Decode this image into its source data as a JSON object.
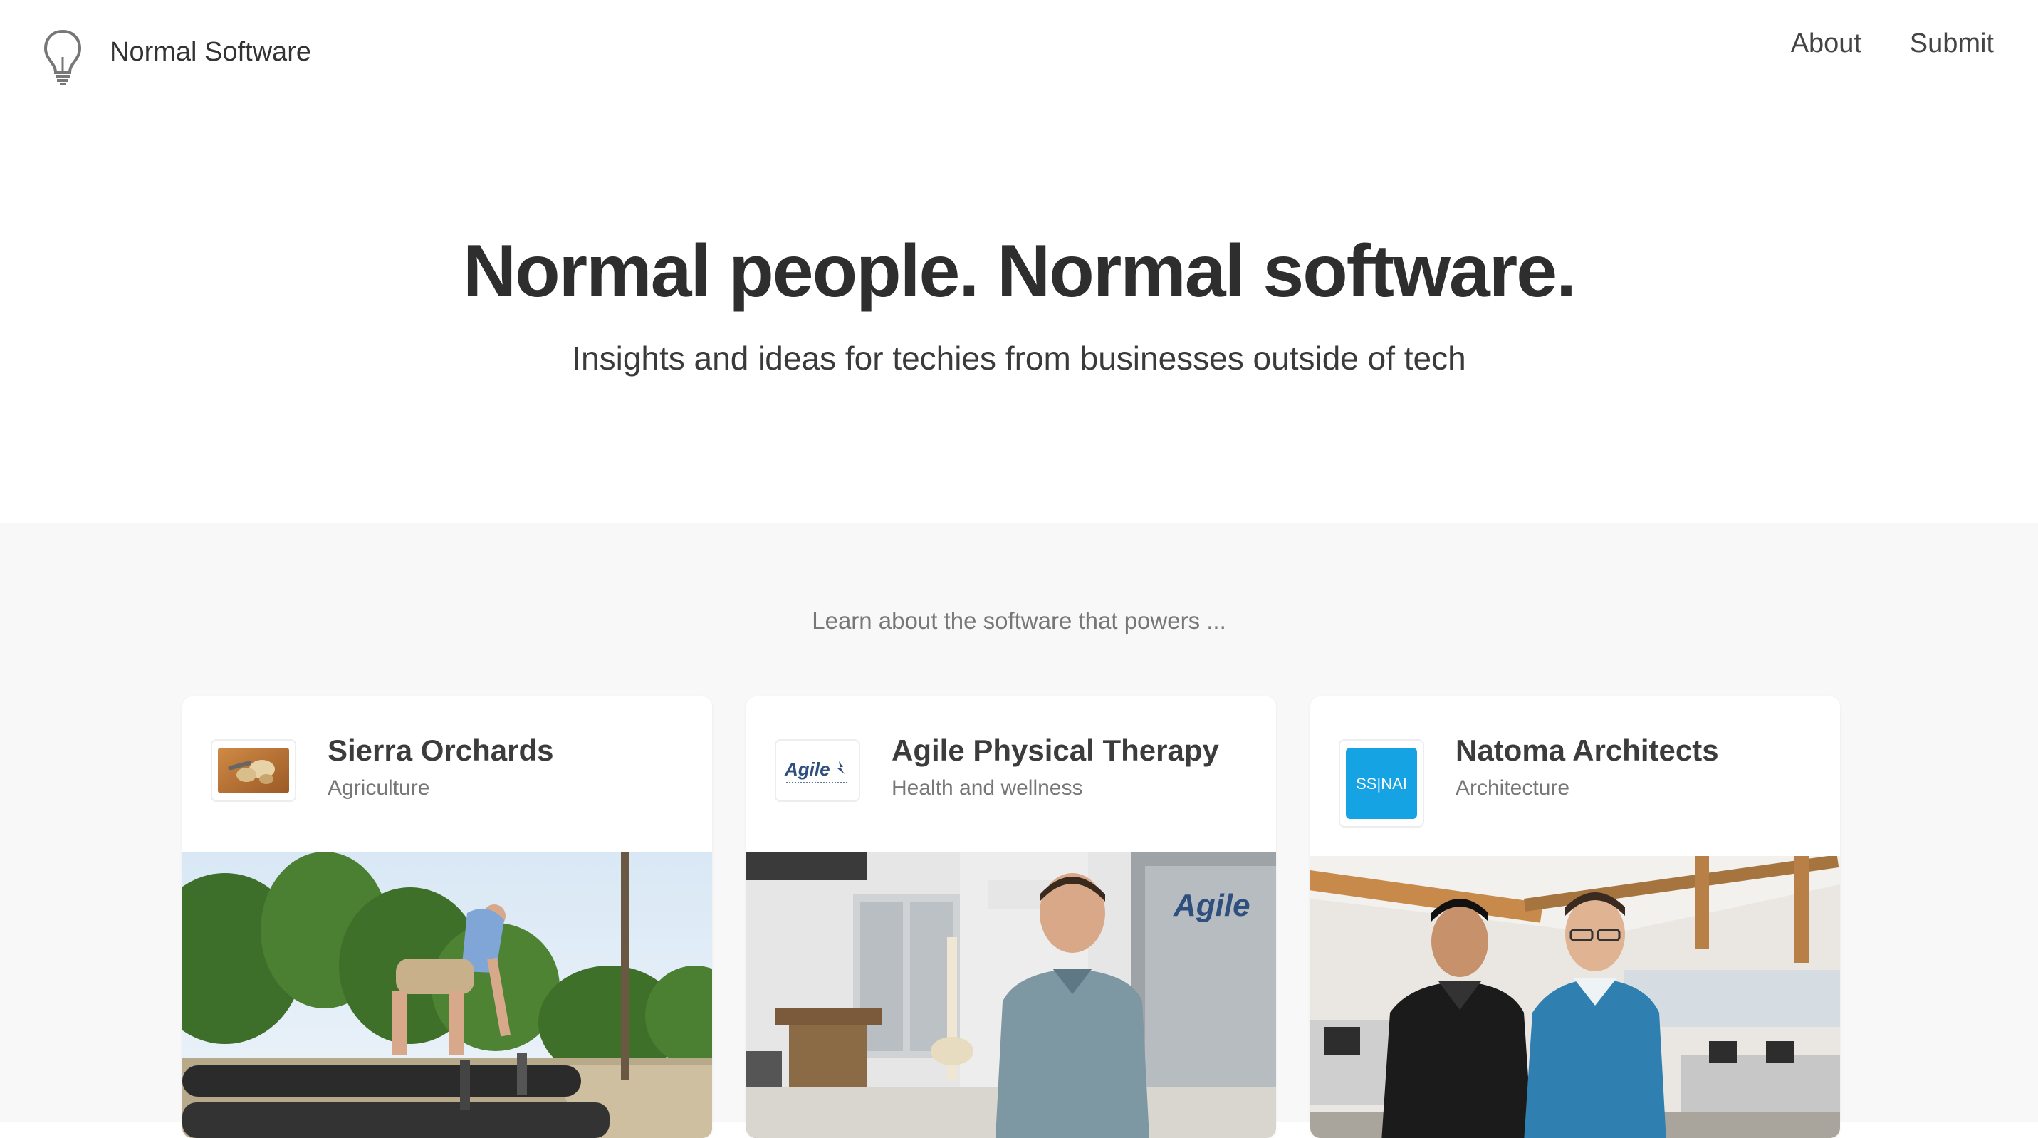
{
  "header": {
    "brand": "Normal Software",
    "nav": {
      "about": "About",
      "submit": "Submit"
    }
  },
  "hero": {
    "title": "Normal people. Normal software.",
    "subtitle": "Insights and ideas for techies from businesses outside of tech"
  },
  "section": {
    "intro": "Learn about the software that powers ..."
  },
  "cards": [
    {
      "title": "Sierra Orchards",
      "category": "Agriculture"
    },
    {
      "title": "Agile Physical Therapy",
      "category": "Health and wellness",
      "logo_text": "Agile"
    },
    {
      "title": "Natoma Architects",
      "category": "Architecture",
      "logo_text": "SS|NAI"
    }
  ],
  "colors": {
    "ssnai_blue": "#16a3e3",
    "agile_navy": "#2f4f7f"
  }
}
